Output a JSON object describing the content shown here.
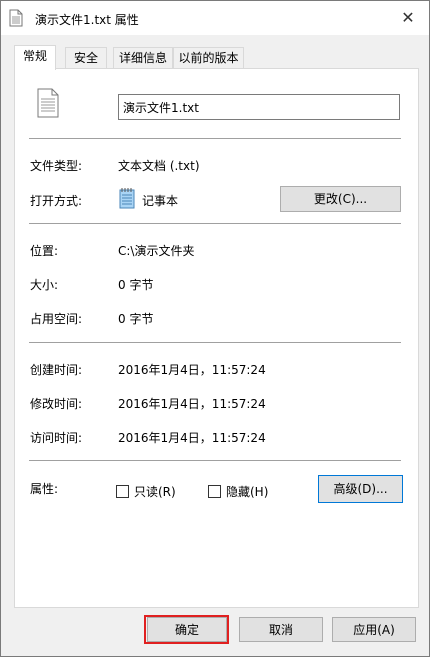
{
  "window": {
    "title": "演示文件1.txt 属性",
    "close_icon": "✕"
  },
  "tabs": [
    {
      "label": "常规",
      "active": true
    },
    {
      "label": "安全"
    },
    {
      "label": "详细信息"
    },
    {
      "label": "以前的版本"
    }
  ],
  "general": {
    "file_name": "演示文件1.txt",
    "type_label": "文件类型:",
    "type_value": "文本文档 (.txt)",
    "opens_with_label": "打开方式:",
    "opens_with_value": "记事本",
    "change_button": "更改(C)...",
    "location_label": "位置:",
    "location_value": "C:\\演示文件夹",
    "size_label": "大小:",
    "size_value": "0 字节",
    "size_on_disk_label": "占用空间:",
    "size_on_disk_value": "0 字节",
    "created_label": "创建时间:",
    "created_value": "2016年1月4日，11:57:24",
    "modified_label": "修改时间:",
    "modified_value": "2016年1月4日，11:57:24",
    "accessed_label": "访问时间:",
    "accessed_value": "2016年1月4日，11:57:24",
    "attributes_label": "属性:",
    "readonly_label": "只读(R)",
    "hidden_label": "隐藏(H)",
    "advanced_button": "高级(D)..."
  },
  "footer": {
    "ok": "确定",
    "cancel": "取消",
    "apply": "应用(A)"
  },
  "colors": {
    "focus_border": "#0078d7",
    "highlight_box": "#e02020"
  }
}
